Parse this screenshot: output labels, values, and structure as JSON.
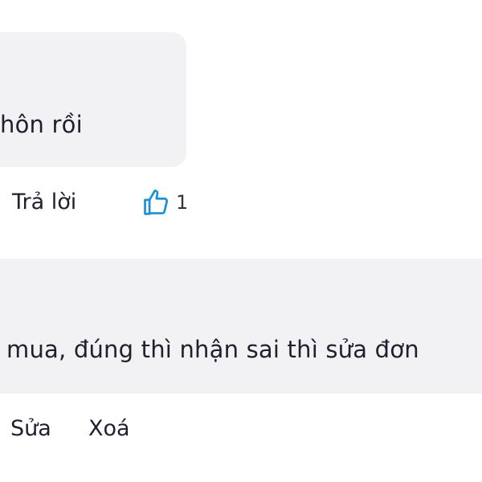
{
  "comment_1": {
    "text_partial": "hôn rồi",
    "actions": {
      "reply_label": "Trả lời",
      "like_icon": "thumbs-up-icon",
      "like_count": "1",
      "like_color": "#1a8fd6"
    }
  },
  "comment_2": {
    "text_partial": "mua, đúng thì nhận sai thì sửa đơn",
    "actions": {
      "edit_label": "Sửa",
      "delete_label": "Xoá"
    }
  },
  "colors": {
    "bubble_bg": "#f2f2f4",
    "text": "#1f1f2e",
    "accent": "#1a8fd6"
  }
}
